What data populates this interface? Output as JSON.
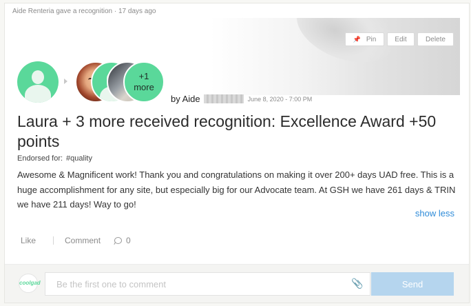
{
  "activity": "Aide Renteria gave a recognition · 17 days ago",
  "header_buttons": {
    "pin": "Pin",
    "edit": "Edit",
    "delete": "Delete"
  },
  "recipients": {
    "more_count": "+1",
    "more_label": "more"
  },
  "byline": {
    "prefix": "by Aide",
    "date": "June 8, 2020 - 7:00 PM"
  },
  "title": "Laura + 3 more received recognition: Excellence Award +50 points",
  "endorsed": {
    "label": "Endorsed for:",
    "tag": "#quality"
  },
  "message": "Awesome & Magnificent work! Thank you and congratulations on making it over 200+ days UAD free. This is a huge accomplishment for any site, but especially big for our Advocate team. At GSH we have 261 days & TRIN we have 211 days! Way to go!",
  "show_less": "show less",
  "actions": {
    "like": "Like",
    "comment": "Comment",
    "comment_count": "0"
  },
  "footer": {
    "logo_text": "coolgad",
    "placeholder": "Be the first one to comment",
    "send": "Send"
  },
  "colors": {
    "accent_green": "#5ad89a",
    "link_blue": "#2e8bd8",
    "send_button": "#b5d5ee"
  },
  "icons": [
    "pin-icon",
    "arrow-right-icon",
    "comment-bubble-icon",
    "paperclip-icon"
  ]
}
